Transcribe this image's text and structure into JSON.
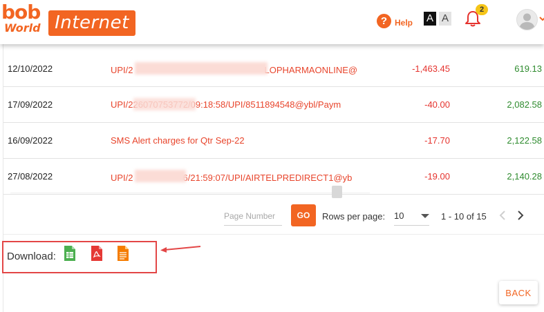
{
  "header": {
    "logo_bob": "bob",
    "logo_world": "World",
    "logo_internet": "Internet",
    "help_label": "Help",
    "font_size_large": "A",
    "font_size_small": "A",
    "notification_count": "2",
    "icons": [
      "help-icon",
      "bell-icon",
      "user-avatar-icon",
      "chevron-down-icon"
    ]
  },
  "transactions": [
    {
      "date": "12/10/2022",
      "desc_prefix": "UPI/2",
      "desc_suffix": "LOPHARMAONLINE@",
      "amount": "-1,463.45",
      "balance": "619.13"
    },
    {
      "date": "17/09/2022",
      "desc_prefix": "UPI/226070753772/09:18:58/UPI/8511894548@ybl/Paym",
      "desc_suffix": "",
      "amount": "-40.00",
      "balance": "2,082.58"
    },
    {
      "date": "16/09/2022",
      "desc_prefix": "SMS Alert charges for Qtr Sep-22",
      "desc_suffix": "",
      "amount": "-17.70",
      "balance": "2,122.58"
    },
    {
      "date": "27/08/2022",
      "desc_prefix": "UPI/2",
      "desc_suffix": "6/21:59:07/UPI/AIRTELPREDIRECT1@yb",
      "amount": "-19.00",
      "balance": "2,140.28"
    }
  ],
  "pagination": {
    "page_number_placeholder": "Page Number",
    "go_label": "GO",
    "rows_per_page_label": "Rows per page:",
    "rows_per_page_value": "10",
    "range_text": "1 - 10 of 15"
  },
  "download": {
    "label": "Download:",
    "formats": [
      "excel-icon",
      "pdf-icon",
      "text-doc-icon"
    ]
  },
  "back_label": "BACK",
  "colors": {
    "brand": "#f26522",
    "debit": "#e5322d",
    "balance": "#2e8b2e",
    "annotation": "#e34646"
  }
}
